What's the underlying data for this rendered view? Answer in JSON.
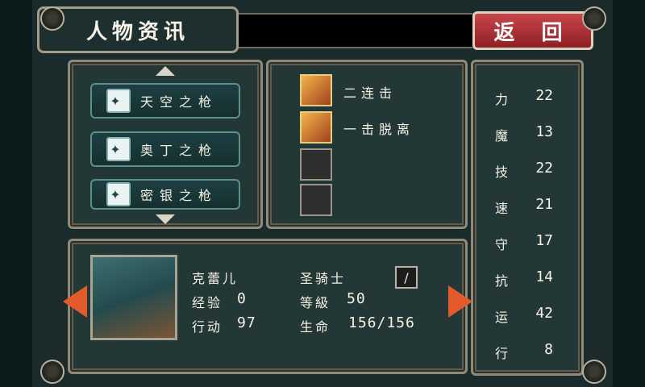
{
  "header": {
    "title": "人物资讯",
    "back_label": "返  回"
  },
  "weapons": [
    {
      "name": "天空之枪",
      "icon": "spear-icon"
    },
    {
      "name": "奥丁之枪",
      "icon": "spear-icon"
    },
    {
      "name": "密银之枪",
      "icon": "spear-icon"
    }
  ],
  "skills": [
    {
      "name": "二连击",
      "icon": "double-strike-icon"
    },
    {
      "name": "一击脱离",
      "icon": "hit-and-away-icon"
    }
  ],
  "stats": [
    {
      "label": "力",
      "value": "22"
    },
    {
      "label": "魔",
      "value": "13"
    },
    {
      "label": "技",
      "value": "22"
    },
    {
      "label": "速",
      "value": "21"
    },
    {
      "label": "守",
      "value": "17"
    },
    {
      "label": "抗",
      "value": "14"
    },
    {
      "label": "运",
      "value": "42"
    },
    {
      "label": "行",
      "value": "8"
    }
  ],
  "character": {
    "name": "克蕾儿",
    "exp_label": "经验",
    "exp_value": "0",
    "move_label": "行动",
    "move_value": "97",
    "class": "圣骑士",
    "level_label": "等級",
    "level_value": "50",
    "hp_label": "生命",
    "hp_value": "156/156",
    "weapon_type_icon": "lance-icon"
  },
  "colors": {
    "accent_red": "#b2363b",
    "panel": "#233737",
    "border": "#8e8b7a",
    "nav_arrow": "#e35a2c"
  }
}
